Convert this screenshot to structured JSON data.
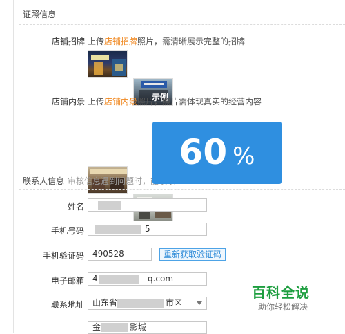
{
  "license_section": {
    "title": "证照信息",
    "storefront": {
      "label": "店铺招牌",
      "hint_prefix": "上传",
      "hint_highlight": "店铺招牌",
      "hint_suffix": "照片，需清晰展示完整的招牌",
      "example_label": "示例"
    },
    "interior": {
      "label": "店铺内景",
      "hint_prefix": "上传",
      "hint_highlight": "店铺内景",
      "hint_suffix": "照片，照片需体现真实的经营内容",
      "example_label": "示例"
    }
  },
  "contact_section": {
    "title": "联系人信息",
    "subtitle": "审核信息遇到问题时，能联系"
  },
  "form": {
    "name_label": "姓名",
    "phone_label": "手机号码",
    "phone_value_tail": "5",
    "code_label": "手机验证码",
    "code_value": "490528",
    "resend_label": "重新获取验证码",
    "email_label": "电子邮箱",
    "email_value_head": "4",
    "email_value_tail": "q.com",
    "address_label": "联系地址",
    "address_province": "山东省",
    "address_district": "市区",
    "address_detail_head": "金",
    "address_detail_tail": "影城"
  },
  "progress": {
    "value": "60",
    "unit": "%"
  },
  "watermark": {
    "title": "百科全说",
    "subtitle": "助你轻松解决"
  },
  "colors": {
    "accent_blue": "#2f8fe0",
    "highlight_orange": "#f08a24",
    "watermark_green": "#1d9e3f"
  }
}
